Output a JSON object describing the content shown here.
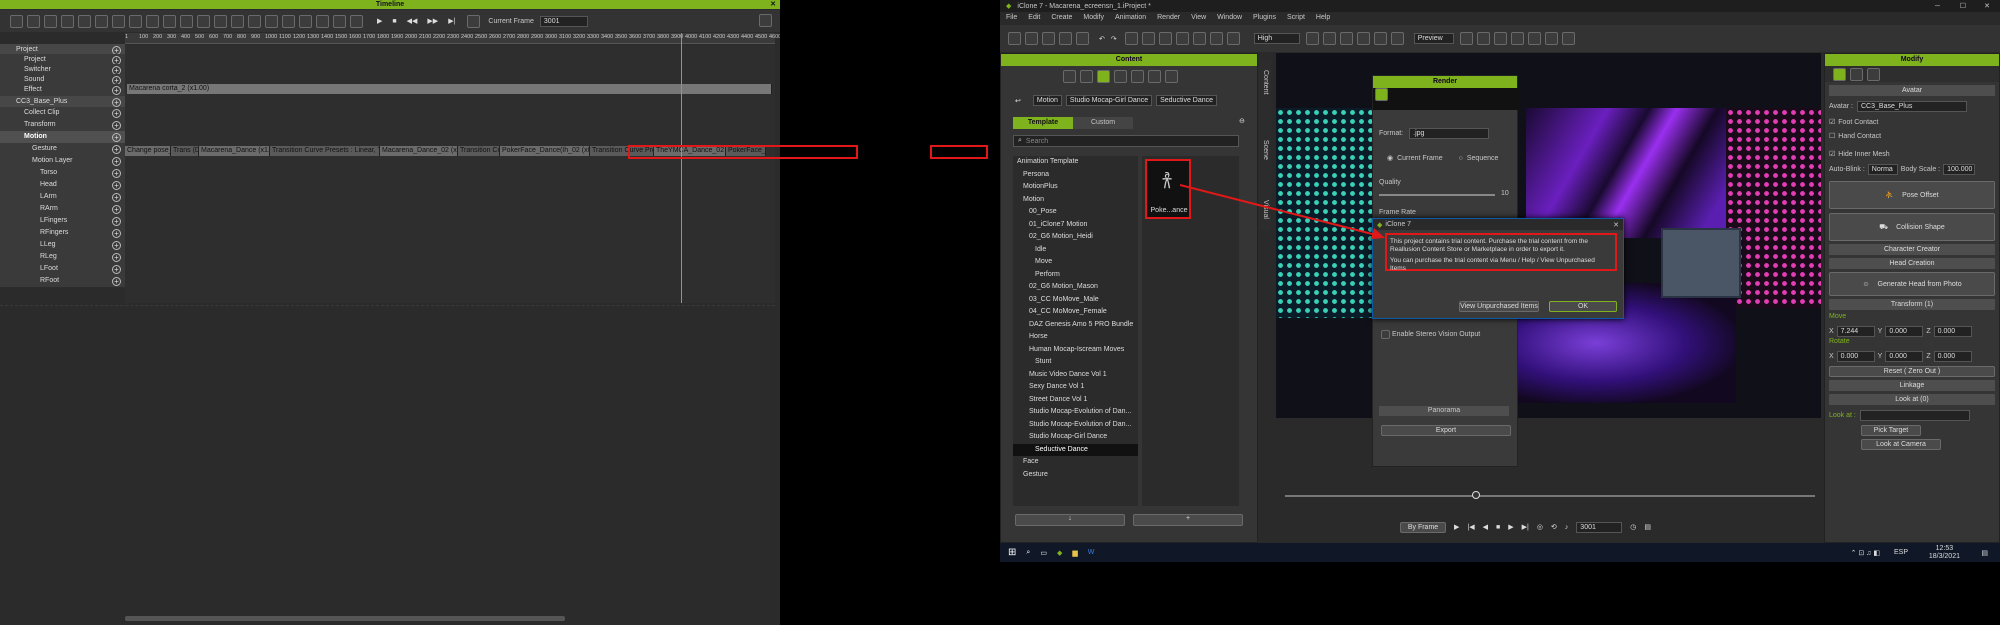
{
  "timeline": {
    "title": "Timeline",
    "current_frame_label": "Current Frame",
    "current_frame_value": "3001",
    "ruler": [
      "1",
      "100",
      "200",
      "300",
      "400",
      "500",
      "600",
      "700",
      "800",
      "900",
      "1000",
      "1100",
      "1200",
      "1300",
      "1400",
      "1500",
      "1600",
      "1700",
      "1800",
      "1900",
      "2000",
      "2100",
      "2200",
      "2300",
      "2400",
      "2500",
      "2600",
      "2700",
      "2800",
      "2900",
      "3000",
      "3100",
      "3200",
      "3300",
      "3400",
      "3500",
      "3600",
      "3700",
      "3800",
      "3900",
      "4000",
      "4100",
      "4200",
      "4300",
      "4400",
      "4500",
      "4600"
    ],
    "tracks": [
      "Project",
      "Project",
      "Switcher",
      "Sound",
      "Effect",
      "CC3_Base_Plus",
      "Collect Clip",
      "Transform",
      "Motion",
      "Gesture",
      "Motion Layer",
      "Torso",
      "Head",
      "LArm",
      "RArm",
      "LFingers",
      "RFingers",
      "LLeg",
      "RLeg",
      "LFoot",
      "RFoot"
    ],
    "sound_clip": "Macarena corta_2 (x1.00)",
    "motion_clips": [
      "Change pose_02 (x1.00)",
      "Trans (Da",
      "Macarena_Dance (x1.00)",
      "Transition Curve Presets : Linear, Time Warp : L",
      "Macarena_Dance_02 (x1.00)",
      "Transition Curve Presets : Linear, Time W",
      "PokerFace_Dance(Ih_02 (x0.80)",
      "Transition Curve Presets : Linear, Time Warp",
      "TheYMCA_Dance_02 (x1.00)",
      "PokerFace_Dance"
    ]
  },
  "iclone": {
    "title": "iClone 7 - Macarena_ecreensn_1.iProject *",
    "menu": [
      "File",
      "Edit",
      "Create",
      "Modify",
      "Animation",
      "Render",
      "View",
      "Window",
      "Plugins",
      "Script",
      "Help"
    ],
    "quality": "High",
    "preview": "Preview",
    "content": {
      "title": "Content",
      "breadcrumb": [
        "Motion",
        "Studio Mocap-Girl Dance",
        "Seductive Dance"
      ],
      "tabs": [
        "Template",
        "Custom"
      ],
      "search_placeholder": "Search",
      "tree": [
        "Animation Template",
        "Persona",
        "MotionPlus",
        "Motion",
        "00_Pose",
        "01_iClone7 Motion",
        "02_G6 Motion_Heidi",
        "Idle",
        "Move",
        "Perform",
        "02_G6 Motion_Mason",
        "03_CC MoMove_Male",
        "04_CC MoMove_Female",
        "DAZ Genesis Amo 5 PRO Bundle",
        "Horse",
        "Human Mocap-Iscream Moves",
        "Stunt",
        "Music Video Dance Vol 1",
        "Sexy Dance Vol 1",
        "Street Dance Vol 1",
        "Studio Mocap-Evolution of Dan...",
        "Studio Mocap-Evolution of Dan...",
        "Studio Mocap-Girl Dance",
        "Seductive Dance",
        "Face",
        "Gesture"
      ],
      "thumb_label": "Poke...ance",
      "side_tabs": [
        "Content",
        "Scene",
        "Visual"
      ]
    },
    "render": {
      "title": "Render",
      "format_label": "Format:",
      "format_value": ".jpg",
      "current_frame": "Current Frame",
      "sequence": "Sequence",
      "quality_label": "Quality",
      "quality_value": "10",
      "frame_rate": "Frame Rate",
      "stereo": "Enable Stereo Vision Output",
      "panorama": "Panorama",
      "export": "Export"
    },
    "dialog": {
      "title": "iClone 7",
      "line1": "This project contains trial content. Purchase the trial content from the Reallusion Content Store or Marketplace in order to export it.",
      "line2": "You can purchase the trial content via Menu / Help / View Unpurchased Items",
      "view_btn": "View Unpurchased Items",
      "ok_btn": "OK"
    },
    "playback": {
      "mode": "By Frame",
      "frame": "3001"
    },
    "modify": {
      "title": "Modify",
      "avatar_section": "Avatar",
      "avatar_label": "Avatar :",
      "avatar_value": "CC3_Base_Plus",
      "foot_contact": "Foot Contact",
      "hand_contact": "Hand Contact",
      "hide_inner_mesh": "Hide Inner Mesh",
      "auto_blink_label": "Auto-Blink :",
      "auto_blink_value": "Norma",
      "body_scale_label": "Body Scale :",
      "body_scale_value": "100.000",
      "pose_offset": "Pose Offset",
      "collision_shape": "Collision Shape",
      "character_creator": "Character Creator",
      "head_creation": "Head Creation",
      "generate_head": "Generate Head from Photo",
      "transform": "Transform (1)",
      "move": "Move",
      "move_x": "7.244",
      "move_y": "0.000",
      "move_z": "0.000",
      "rotate": "Rotate",
      "rot_x": "0.000",
      "rot_y": "0.000",
      "rot_z": "0.000",
      "reset": "Reset ( Zero Out )",
      "linkage": "Linkage",
      "look_at": "Look at (0)",
      "look_at_label": "Look at :",
      "pick_target": "Pick Target",
      "look_at_camera": "Look at Camera"
    },
    "taskbar": {
      "lang": "ESP",
      "time": "12:53",
      "date": "18/3/2021"
    }
  },
  "colors": {
    "accent": "#7fb31d",
    "dialog_border": "#e01818",
    "win_blue": "#0c5aa6"
  }
}
